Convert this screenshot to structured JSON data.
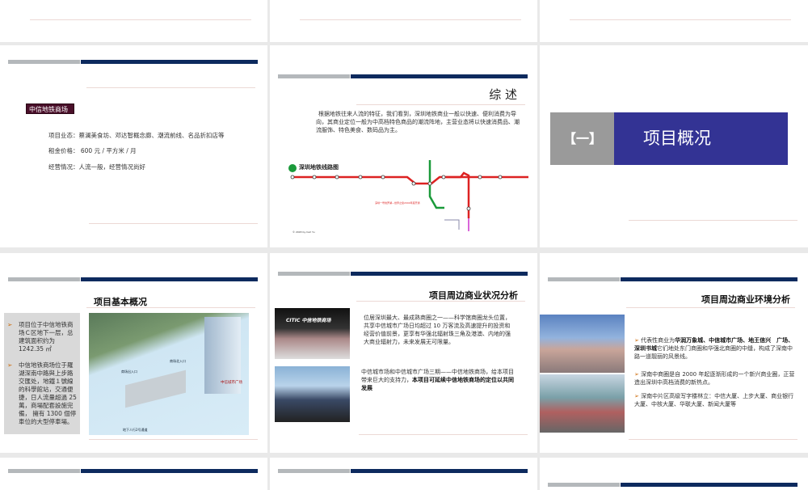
{
  "slides": [
    {
      "index": 1
    },
    {
      "index": 2
    },
    {
      "index": 3
    },
    {
      "index": 4,
      "label": "中信地铁商场",
      "lines": [
        "项目业态：蔡澜美食坊、邓达智概念廊、潮流前线、名品折扣店等",
        "租金价格： 600 元 / 平方米 / 月",
        "经营情况：人流一般，经营情况尚好"
      ]
    },
    {
      "index": 5,
      "title": "综 述",
      "paragraph": "根据地铁往来人流的特征，我们看到，深圳地铁商业一般以快速、便利消费为导向，其商业定位一般为中高档特色商品的潮流阵地，主营业态将以快速消费品、潮流服饰、特色美食、数码品为主。",
      "map_title": "深圳地铁线路图",
      "map_credit": "2003 by Carl Yu"
    },
    {
      "index": 6,
      "number": "【一】",
      "title": "项目概况"
    },
    {
      "index": 7,
      "title": "项目基本概况",
      "bullets": [
        "项目位于中信地铁商场Ｃ区地下一层，总建筑面积约为1242.35 ㎡",
        "中信地铁商场位于羅湖深南中路與上步路交匯处，地鐵１號線的科學館站，交通便捷，日人流量超過 25 萬，商場配套設施完備， 擁有 1300 個停車位的大型停車場。"
      ],
      "image_labels": {
        "entrance1": "商场出入口",
        "entrance2": "商场北入口",
        "plaza": "中信城市广场",
        "underpass": "地下人行2号通道"
      }
    },
    {
      "index": 8,
      "title": "项目周边商业状况分析",
      "para1": "位居深圳最大、最成熟商圈之一——科学馆商圈龙头位置，共享中信城市广场日均超过 10 万客流及高速提升的投资和经营价值前景，更享有华强北辐射珠三角及港澳、内地的强大商业辐射力，未来发展无可限量。",
      "para2_plain": "中信城市场和中信城市广场三期——中信地铁商场，给本项目带来巨大的支持力，",
      "para2_bold": "本项目可延续中信地铁商场的定位以共同发展",
      "photo_sign": "CITIC 中信地铁商场"
    },
    {
      "index": 9,
      "title": "项目周边商业环境分析",
      "b1_pre": "代表性商业为",
      "b1_bold": "华润万象城、中信城市广场、地王信兴　广场、深圳书城",
      "b1_post": "它们地处东门商圈和华强北商圈的中缝，构成了深南中路一道靓丽的风景线。",
      "b2": "深南中商圈是自 2000 年起逐渐形成的一个新兴商业圈，正营造出深圳中高档消费的新热点。",
      "b3": "深南中片区高级写字楼林立：中信大厦、上步大厦、商业银行大厦、中核大厦、华联大厦、新闻大厦等"
    },
    {
      "index": 10
    },
    {
      "index": 11
    },
    {
      "index": 12
    }
  ],
  "colors": {
    "navy": "#0d2a5e",
    "gray_bar": "#b4b8bb",
    "section_blue": "#333394",
    "label_bg": "#4a0f2a"
  }
}
